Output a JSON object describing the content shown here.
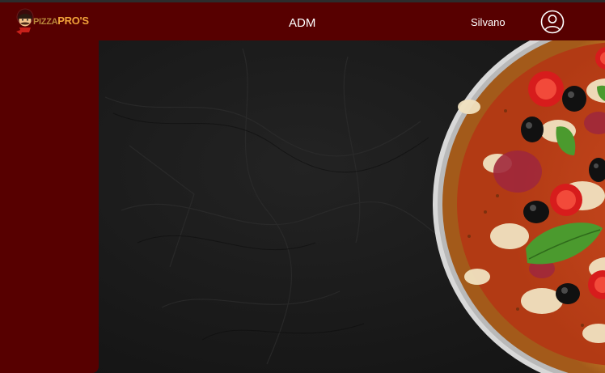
{
  "header": {
    "logo": {
      "text_part1": "PIZZA",
      "text_part2": "PRO'S",
      "icon": "chef-mascot-icon"
    },
    "title": "ADM",
    "username": "Silvano",
    "profile_icon": "user-circle-icon"
  },
  "sidebar": {
    "items": []
  },
  "colors": {
    "brand_dark_red": "#570000",
    "background": "#1a1a1a",
    "logo_gold": "#f2a33a",
    "text": "#ffffff"
  },
  "hero_image": "pizza-image"
}
